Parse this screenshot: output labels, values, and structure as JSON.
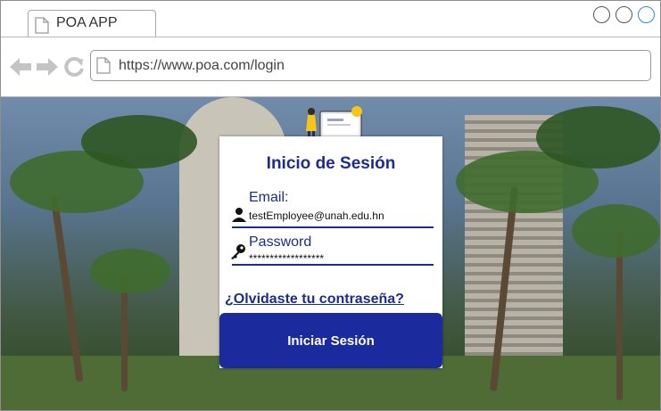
{
  "browser": {
    "tab_title": "POA APP",
    "url": "https://www.poa.com/login",
    "icons": {
      "back": "arrow-left-icon",
      "forward": "arrow-right-icon",
      "reload": "reload-icon",
      "page": "document-icon"
    }
  },
  "login": {
    "title": "Inicio de Sesión",
    "email_label": "Email:",
    "email_value": "testEmployee@unah.edu.hn",
    "password_label": "Password",
    "password_value": "******************",
    "forgot_link": "¿Olvidaste tu contraseña?",
    "submit_label": "Iniciar Sesión"
  },
  "colors": {
    "accent": "#1b2a9c",
    "label": "#1e2b8f"
  }
}
